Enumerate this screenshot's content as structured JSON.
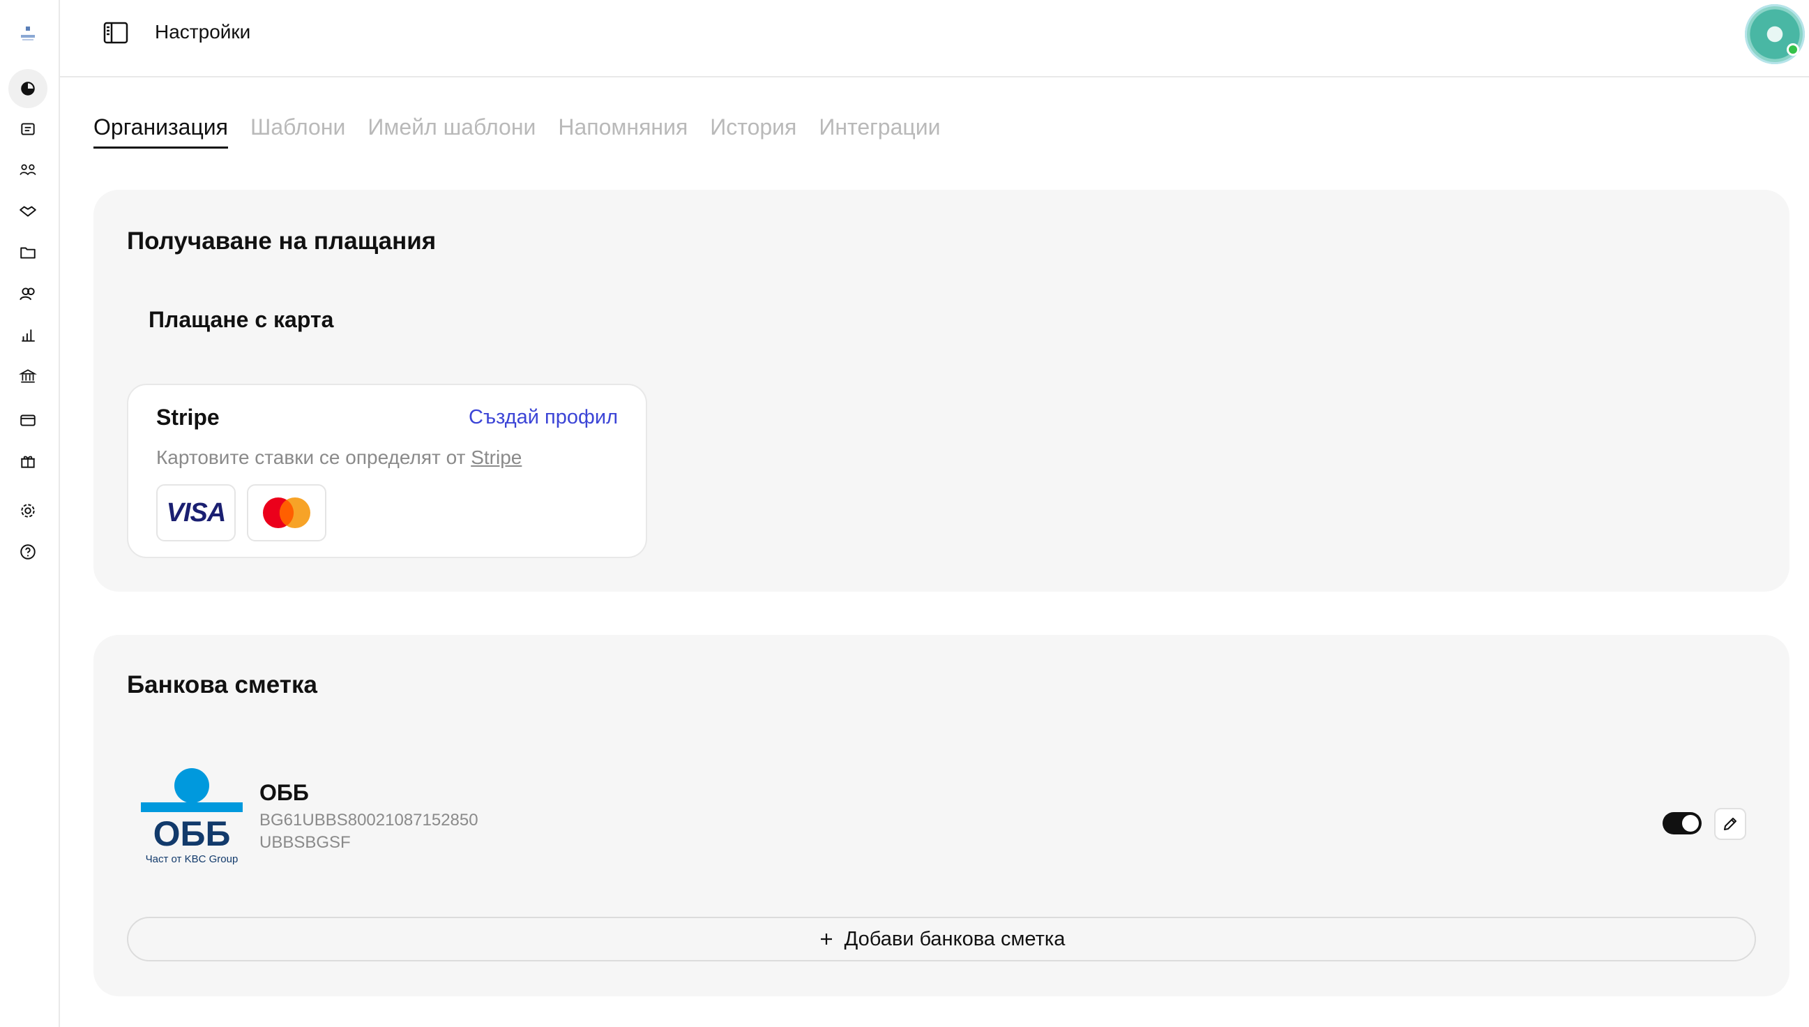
{
  "header": {
    "title": "Настройки"
  },
  "sidebar": {
    "logo_icon": "app-logo",
    "items": [
      {
        "icon": "pie-chart-icon",
        "active": true
      },
      {
        "icon": "invoice-icon"
      },
      {
        "icon": "clients-icon"
      },
      {
        "icon": "handshake-icon"
      },
      {
        "icon": "folder-icon"
      },
      {
        "icon": "users-icon"
      },
      {
        "icon": "bar-chart-icon"
      },
      {
        "icon": "bank-icon"
      },
      {
        "icon": "wallet-icon"
      },
      {
        "icon": "gift-icon"
      },
      {
        "icon": "gear-icon"
      },
      {
        "icon": "help-icon"
      }
    ]
  },
  "tabs": [
    {
      "label": "Организация",
      "active": true
    },
    {
      "label": "Шаблони"
    },
    {
      "label": "Имейл шаблони"
    },
    {
      "label": "Напомняния"
    },
    {
      "label": "История"
    },
    {
      "label": "Интеграции"
    }
  ],
  "payments": {
    "title": "Получаване на плащания",
    "card_title": "Плащане с карта",
    "provider": {
      "name": "Stripe",
      "action": "Създай профил",
      "desc_prefix": "Картовите ставки се определят от",
      "desc_link": "Stripe",
      "logos": [
        "visa-logo",
        "mastercard-logo"
      ],
      "visa_text": "VISA"
    }
  },
  "bank": {
    "title": "Банкова сметка",
    "accounts": [
      {
        "name": "ОББ",
        "iban": "BG61UBBS80021087152850",
        "bic": "UBBSBGSF",
        "logo_text": "ОББ",
        "logo_sub": "Част от KBC Group",
        "enabled": true
      }
    ],
    "add_label": "Добави банкова сметка"
  },
  "colors": {
    "accent_link": "#3b44d6",
    "card_bg": "#f6f6f6",
    "online": "#35c24a"
  }
}
